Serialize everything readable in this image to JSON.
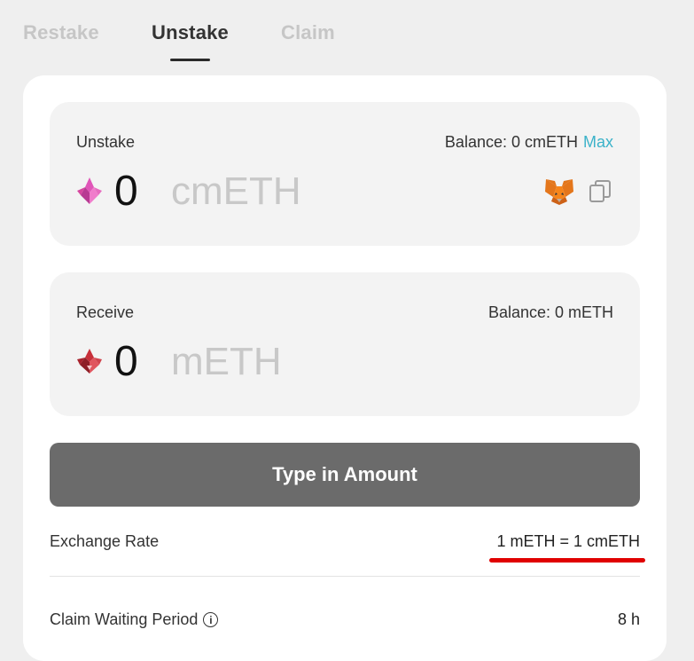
{
  "tabs": [
    {
      "label": "Restake"
    },
    {
      "label": "Unstake"
    },
    {
      "label": "Claim"
    }
  ],
  "unstake_panel": {
    "label": "Unstake",
    "balance_text": "Balance: 0 cmETH",
    "max_label": "Max",
    "amount": "0",
    "token": "cmETH",
    "token_icon": "cmeth-icon",
    "wallet_icon": "metamask-fox-icon",
    "copy_icon": "copy-icon"
  },
  "receive_panel": {
    "label": "Receive",
    "balance_text": "Balance: 0 mETH",
    "amount": "0",
    "token": "mETH",
    "token_icon": "meth-icon"
  },
  "action_button": {
    "label": "Type in Amount"
  },
  "exchange_rate": {
    "label": "Exchange Rate",
    "value": "1 mETH = 1 cmETH"
  },
  "claim_waiting": {
    "label": "Claim Waiting Period",
    "info_icon": "info-icon",
    "value": "8 h"
  },
  "colors": {
    "background": "#efefef",
    "card": "#ffffff",
    "panel": "#f3f3f3",
    "button": "#6b6b6b",
    "max_link": "#3bb2c9",
    "annotation": "#e00000"
  }
}
